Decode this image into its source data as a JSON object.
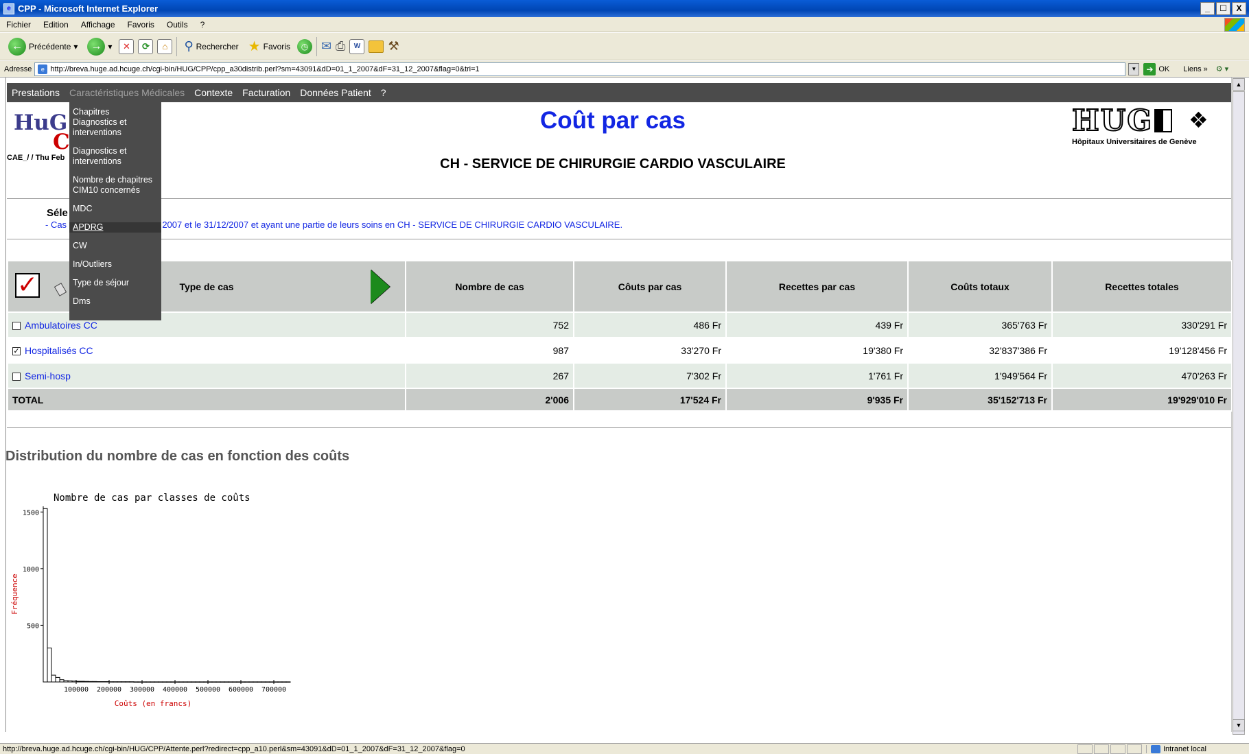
{
  "window": {
    "title": "CPP - Microsoft Internet Explorer",
    "controls": [
      "_",
      "☐",
      "X"
    ]
  },
  "menubar": [
    "Fichier",
    "Edition",
    "Affichage",
    "Favoris",
    "Outils",
    "?"
  ],
  "toolbar": {
    "back": "Précédente",
    "search": "Rechercher",
    "favorites": "Favoris"
  },
  "addressbar": {
    "label": "Adresse",
    "url": "http://breva.huge.ad.hcuge.ch/cgi-bin/HUG/CPP/cpp_a30distrib.perl?sm=43091&dD=01_1_2007&dF=31_12_2007&flag=0&tri=1",
    "go": "OK",
    "links": "Liens"
  },
  "sitenav": [
    "Prestations",
    "Caractéristiques Médicales",
    "Contexte",
    "Facturation",
    "Données Patient",
    "?"
  ],
  "dropdown": [
    "Chapitres",
    "Diagnostics et interventions",
    "Diagnostics et interventions",
    "Nombre de chapitres CIM10 concernés",
    "MDC",
    "APDRG",
    "CW",
    "In/Outliers",
    "Type de séjour",
    "Dms"
  ],
  "header": {
    "logo_left": "HuG",
    "logo_left_c": "C",
    "subhead": "CAE_/ / Thu Feb",
    "title": "Coût par cas",
    "service": "CH - SERVICE DE CHIRURGIE CARDIO VASCULAIRE",
    "hug_logo": "HUG",
    "hug_tagline": "Hôpitaux Universitaires de Genève"
  },
  "selection": {
    "title": "Séle",
    "text_start": "- Cas",
    "text_end": "2007 et le 31/12/2007 et ayant une partie de leurs soins en CH - SERVICE DE CHIRURGIE CARDIO VASCULAIRE."
  },
  "table": {
    "headers": [
      "Type de cas",
      "Nombre de cas",
      "Côuts par cas",
      "Recettes par cas",
      "Coûts totaux",
      "Recettes totales"
    ],
    "rows": [
      {
        "label": "Ambulatoires CC",
        "checked": false,
        "values": [
          "752",
          "486 Fr",
          "439 Fr",
          "365'763 Fr",
          "330'291 Fr"
        ]
      },
      {
        "label": "Hospitalisés CC",
        "checked": true,
        "values": [
          "987",
          "33'270 Fr",
          "19'380 Fr",
          "32'837'386 Fr",
          "19'128'456 Fr"
        ]
      },
      {
        "label": "Semi-hosp",
        "checked": false,
        "values": [
          "267",
          "7'302 Fr",
          "1'761 Fr",
          "1'949'564 Fr",
          "470'263 Fr"
        ]
      }
    ],
    "total": {
      "label": "TOTAL",
      "values": [
        "2'006",
        "17'524 Fr",
        "9'935 Fr",
        "35'152'713 Fr",
        "19'929'010 Fr"
      ]
    }
  },
  "distribution_title": "Distribution du nombre de cas en fonction des coûts",
  "chart_data": {
    "type": "bar",
    "title": "Nombre de cas par classes de coûts",
    "xlabel": "Coûts (en francs)",
    "ylabel": "Fréquence",
    "yticks": [
      500,
      1000,
      1500
    ],
    "xticks": [
      100000,
      200000,
      300000,
      400000,
      500000,
      600000,
      700000
    ],
    "ylim": [
      0,
      1550
    ],
    "xlim": [
      0,
      750000
    ],
    "bin_width": 12500,
    "values": [
      1530,
      300,
      60,
      40,
      20,
      12,
      10,
      8,
      6,
      6,
      5,
      4,
      4,
      3,
      3,
      3,
      2,
      2,
      2,
      2,
      2,
      2,
      1,
      1,
      1,
      1,
      1,
      1,
      1,
      1,
      1,
      1,
      1,
      1,
      1,
      1,
      1,
      1,
      1,
      1,
      1,
      1,
      1,
      1,
      1,
      1,
      1,
      1,
      1,
      1,
      1,
      1,
      1,
      1,
      1,
      1,
      1,
      1,
      1,
      1
    ]
  },
  "statusbar": {
    "url": "http://breva.huge.ad.hcuge.ch/cgi-bin/HUG/CPP/Attente.perl?redirect=cpp_a10.perl&sm=43091&dD=01_1_2007&dF=31_12_2007&flag=0",
    "zone": "Intranet local"
  }
}
